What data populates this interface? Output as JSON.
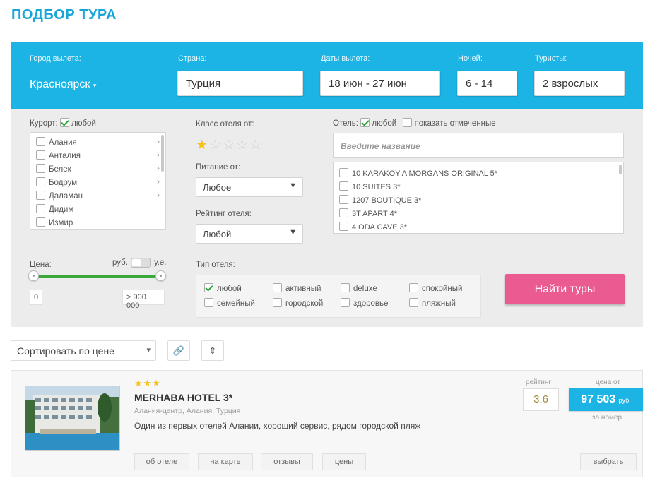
{
  "page": {
    "title": "ПОДБОР ТУРА"
  },
  "search": {
    "city_label": "Город вылета:",
    "city_value": "Красноярск",
    "country_label": "Страна:",
    "country_value": "Турция",
    "dates_label": "Даты вылета:",
    "dates_value": "18 июн - 27 июн",
    "nights_label": "Ночей:",
    "nights_value": "6 - 14",
    "tourists_label": "Туристы:",
    "tourists_value": "2 взрослых"
  },
  "filters": {
    "resort_label": "Курорт:",
    "resort_any": "любой",
    "resorts": [
      "Алания",
      "Анталия",
      "Белек",
      "Бодрум",
      "Даламан",
      "Дидим",
      "Измир"
    ],
    "hotel_class_label": "Класс отеля от:",
    "hotel_class_stars": 1,
    "food_label": "Питание от:",
    "food_value": "Любое",
    "rating_label": "Рейтинг отеля:",
    "rating_value": "Любой",
    "hotel_label": "Отель:",
    "hotel_any": "любой",
    "show_marked": "показать отмеченные",
    "hotel_placeholder": "Введите название",
    "hotels": [
      "10 KARAKOY A MORGANS ORIGINAL 5*",
      "10 SUITES 3*",
      "1207 BOUTIQUE 3*",
      "3T APART 4*",
      "4 ODA CAVE 3*"
    ],
    "price_label": "Цена:",
    "currency_rub": "руб.",
    "currency_ue": "у.е.",
    "price_min": "0",
    "price_max": "> 900 000",
    "type_label": "Тип отеля:",
    "types_row1": [
      "любой",
      "активный",
      "deluxe",
      "спокойный"
    ],
    "types_row2": [
      "семейный",
      "городской",
      "здоровье",
      "пляжный"
    ]
  },
  "actions": {
    "find_label": "Найти туры"
  },
  "results": {
    "sort_label": "Сортировать по цене",
    "hotel": {
      "stars": "★★★",
      "name": "MERHABA HOTEL 3*",
      "location": "Алания-центр, Алания, Турция",
      "description": "Один из первых отелей Алании, хороший сервис, рядом городской пляж",
      "rating_label": "рейтинг",
      "rating": "3.6",
      "price_from_label": "цена от",
      "price": "97 503",
      "price_currency": "руб.",
      "per_room": "за номер",
      "btn_about": "об отеле",
      "btn_map": "на карте",
      "btn_reviews": "отзывы",
      "btn_prices": "цены",
      "btn_choose": "выбрать"
    }
  },
  "colors": {
    "accent": "#1bb4e4",
    "button_pink": "#e95b91",
    "slider_green": "#3aa93a",
    "star": "#f3c318"
  }
}
